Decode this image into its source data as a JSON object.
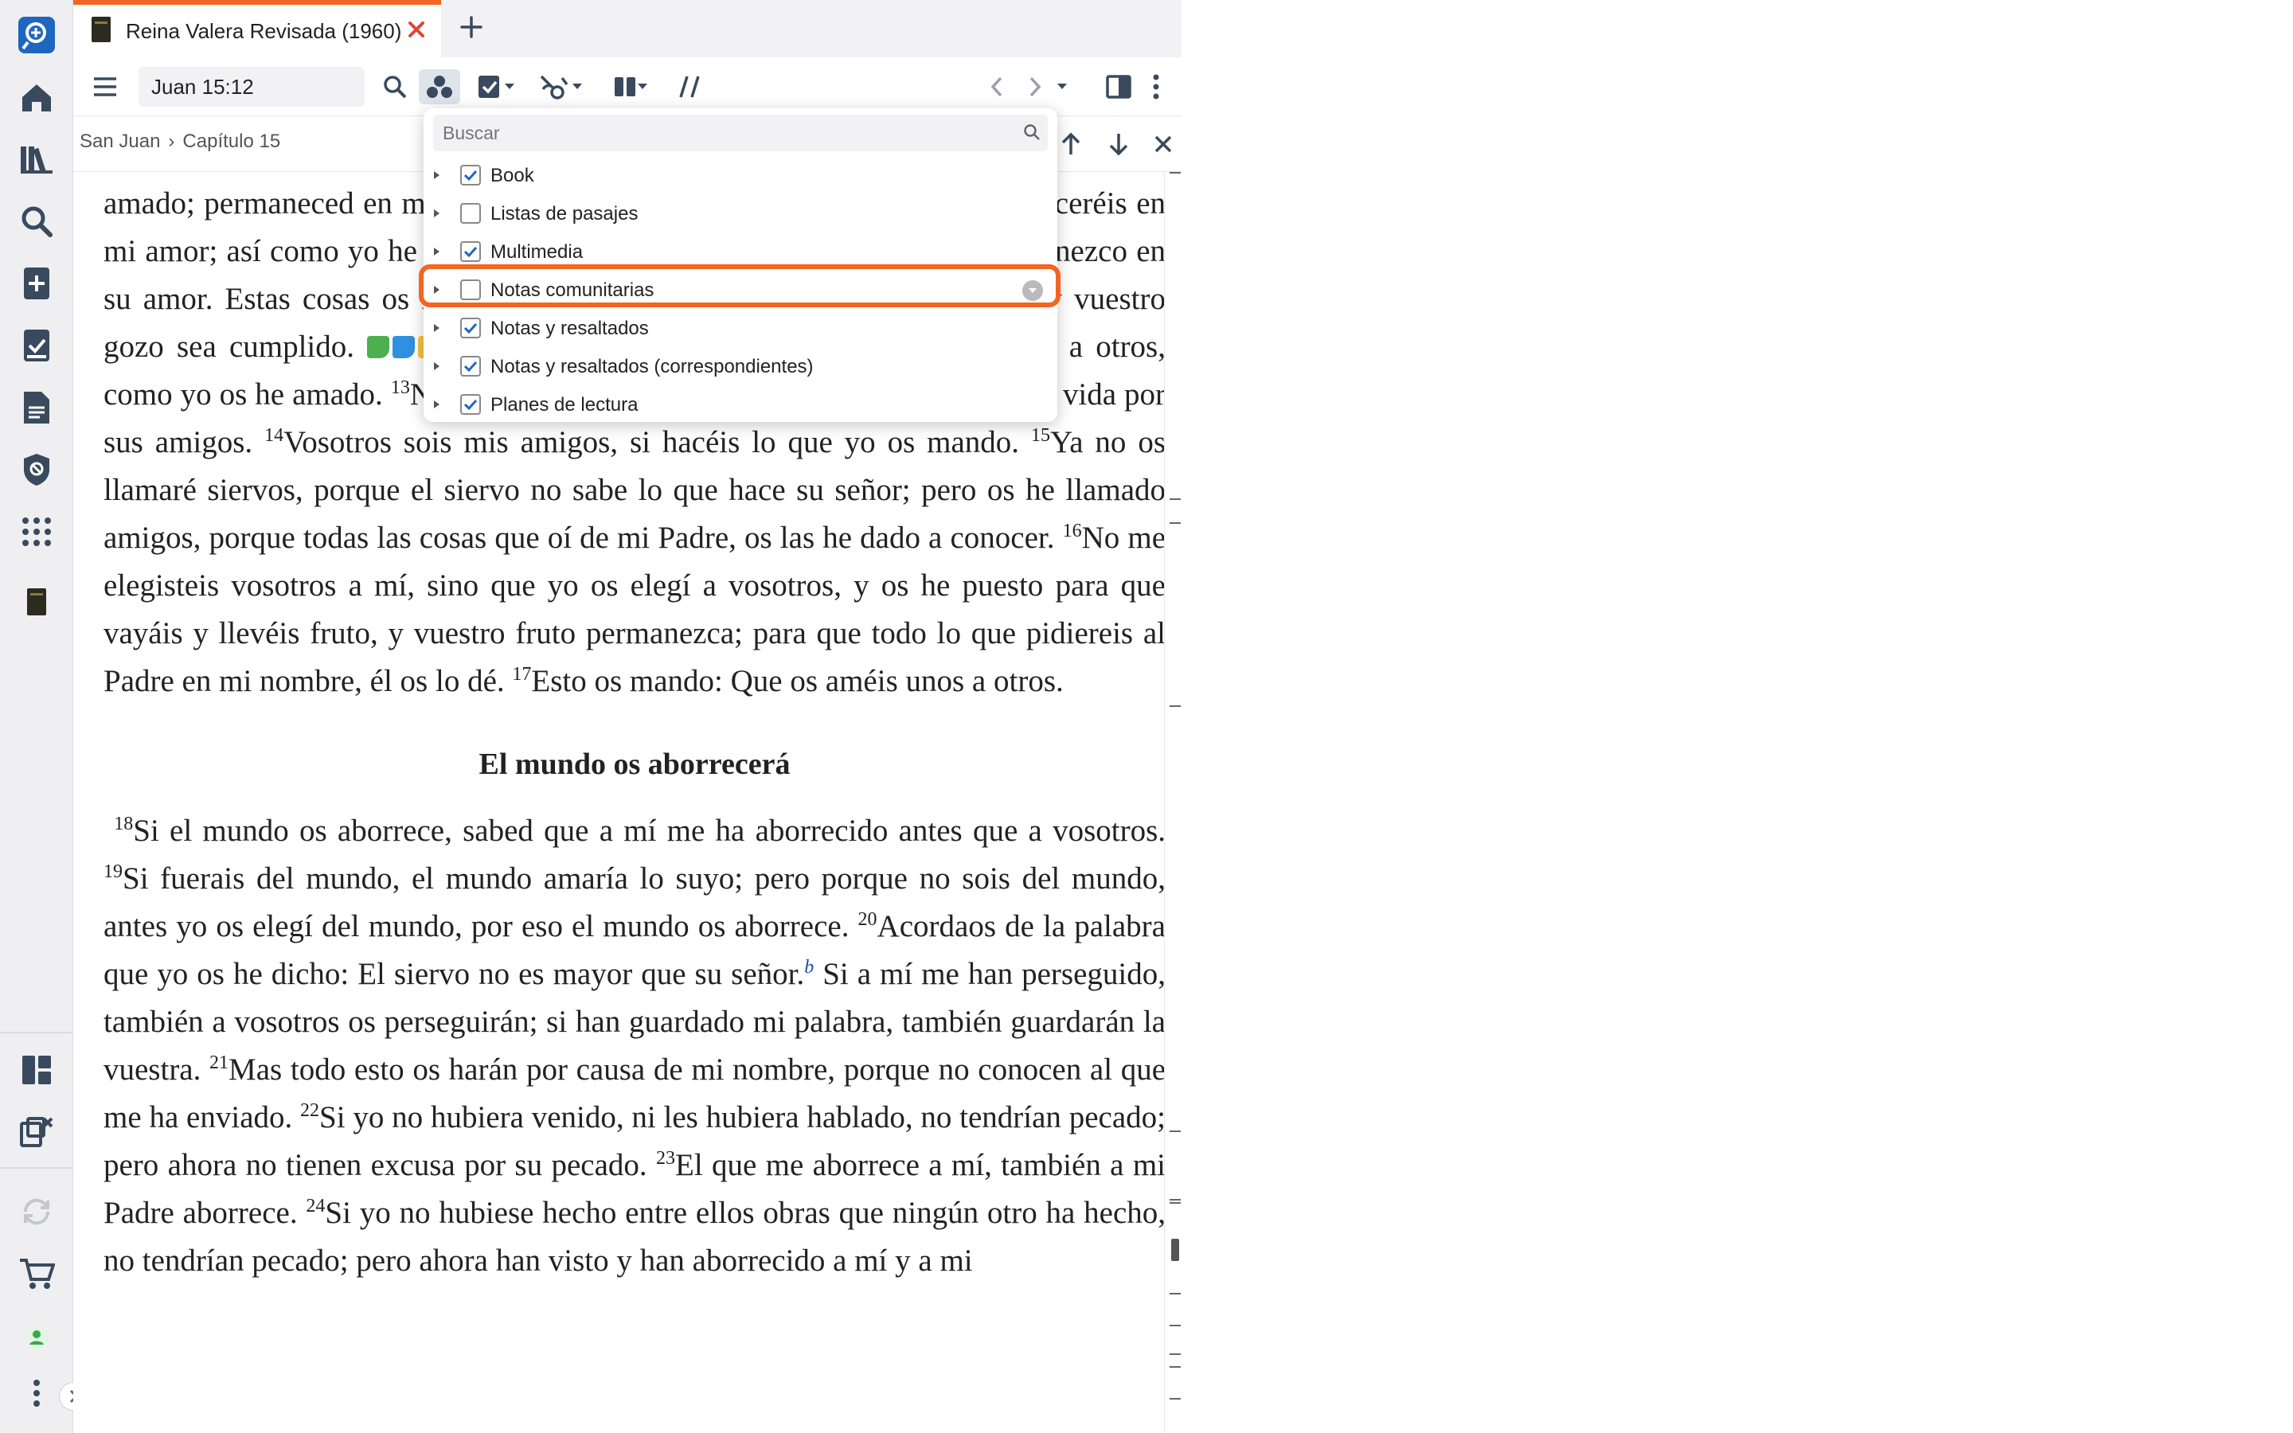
{
  "tab": {
    "title": "Reina Valera Revisada (1960)"
  },
  "toolbar": {
    "reference_value": "Juan 15:12"
  },
  "breadcrumb": {
    "book": "San Juan",
    "separator": "›",
    "chapter": "Capítulo 15"
  },
  "popup": {
    "search_placeholder": "Buscar",
    "options": [
      {
        "label": "Book",
        "checked": true
      },
      {
        "label": "Listas de pasajes",
        "checked": false
      },
      {
        "label": "Multimedia",
        "checked": true
      },
      {
        "label": "Notas comunitarias",
        "checked": false
      },
      {
        "label": "Notas y resaltados",
        "checked": true
      },
      {
        "label": "Notas y resaltados (correspondientes)",
        "checked": true
      },
      {
        "label": "Planes de lectura",
        "checked": true
      }
    ]
  },
  "text": {
    "line1": "amado; permaneced en mi amor. Si guardareis mis mandamientos,",
    "line2": "permaneceréis en mi amor; así como yo he guardado los mandamientos de mi",
    "line3": "Padre, y permanezco en su amor. Estas cosas os he hablado, para que mi",
    "line4": "gozo esté en vosotros, y vuestro gozo sea cumplido.",
    "v12n": "12",
    "v12": "Este es mi mandamiento: Que os améis unos a otros, como yo os he amado.",
    "v13n": "13",
    "v13": "Nadie tiene mayor amor que este, que uno ponga su vida por sus amigos.",
    "v14n": "14",
    "v14": "Vosotros sois mis amigos, si hacéis lo que yo os mando.",
    "v15n": "15",
    "v15": "Ya no os llamaré siervos, porque el siervo no sabe lo que hace su señor; pero os he llamado amigos, porque todas las cosas que oí de mi Padre, os las he dado a conocer.",
    "v16n": "16",
    "v16": "No me elegisteis vosotros a mí, sino que yo os elegí a vosotros, y os he puesto para que vayáis y llevéis fruto, y vuestro fruto permanezca; para que todo lo que pidiereis al Padre en mi nombre, él os lo dé.",
    "v17n": "17",
    "v17": "Esto os mando: Que os améis unos a otros.",
    "heading": "El mundo os aborrecerá",
    "v18n": "18",
    "v18": "Si el mundo os aborrece, sabed que a mí me ha aborrecido antes que a vosotros.",
    "v19n": "19",
    "v19": "Si fuerais del mundo, el mundo amaría lo suyo; pero porque no sois del mundo, antes yo os elegí del mundo, por eso el mundo os aborrece.",
    "v20n": "20",
    "v20": "Acordaos de la palabra que yo os he dicho: El siervo no es mayor que su señor.",
    "fn": "b",
    "v20b": " Si a mí me han perseguido, también a vosotros os perseguirán; si han guardado mi palabra, también guardarán la vuestra.",
    "v21n": "21",
    "v21": "Mas todo esto os harán por causa de mi nombre, porque no conocen al que me ha enviado.",
    "v22n": "22",
    "v22": "Si yo no hubiera venido, ni les hubiera hablado, no tendrían pecado; pero ahora no tienen excusa por su pecado.",
    "v23n": "23",
    "v23": "El que me aborrece a mí, también a mi Padre aborrece.",
    "v24n": "24",
    "v24": "Si yo no hubiese hecho entre ellos obras que ningún otro ha hecho, no tendrían pecado; pero ahora han visto y han aborrecido a mí y a mi"
  },
  "colors": {
    "accent": "#f26522",
    "note_green": "#4caf50",
    "note_blue": "#2f8fe0",
    "note_yellow": "#f5c242"
  }
}
